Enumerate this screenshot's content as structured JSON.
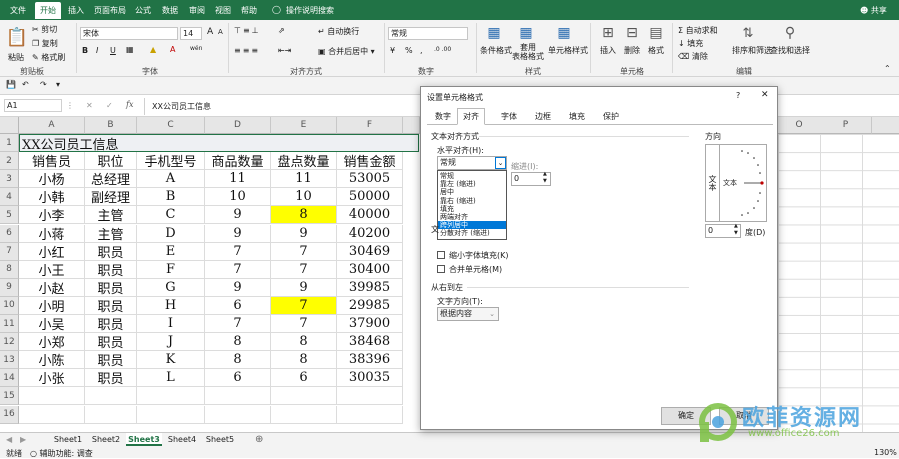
{
  "ribbon_tabs": [
    "文件",
    "开始",
    "插入",
    "页面布局",
    "公式",
    "数据",
    "审阅",
    "视图",
    "帮助",
    "操作说明搜索",
    "共享"
  ],
  "ribbon": {
    "clipboard": {
      "cut": "剪切",
      "copy": "复制",
      "format_painter": "格式刷",
      "paste": "粘贴",
      "label": "剪贴板"
    },
    "font": {
      "name": "宋体",
      "size": "14",
      "label": "字体",
      "bold": "B",
      "italic": "I",
      "underline": "U",
      "grow": "A",
      "shrink": "A",
      "wen": "wén"
    },
    "align": {
      "wrap": "自动换行",
      "merge": "合并后居中",
      "label": "对齐方式"
    },
    "number": {
      "format": "常规",
      "label": "数字",
      "pct": "%",
      "comma": ","
    },
    "styles": {
      "cond": "条件格式",
      "table": "套用\n表格格式",
      "cell": "单元格样式",
      "label": "样式"
    },
    "cells": {
      "insert": "插入",
      "delete": "删除",
      "format": "格式",
      "label": "单元格"
    },
    "editing": {
      "autosum": "自动求和",
      "fill": "填充",
      "clear": "清除",
      "sort": "排序和筛选",
      "find": "查找和选择",
      "label": "编辑"
    }
  },
  "formula_bar": {
    "name_box": "A1",
    "fx": "fx",
    "value": "XX公司员工信息"
  },
  "columns": [
    "A",
    "B",
    "C",
    "D",
    "E",
    "F"
  ],
  "extra_columns": [
    "O",
    "P"
  ],
  "rows": [
    {
      "n": "1",
      "title": "XX公司员工信息"
    },
    {
      "n": "2",
      "cells": [
        "销售员",
        "职位",
        "手机型号",
        "商品数量",
        "盘点数量",
        "销售金额"
      ]
    },
    {
      "n": "3",
      "cells": [
        "小杨",
        "总经理",
        "A",
        "11",
        "11",
        "53005"
      ]
    },
    {
      "n": "4",
      "cells": [
        "小韩",
        "副经理",
        "B",
        "10",
        "10",
        "50000"
      ]
    },
    {
      "n": "5",
      "cells": [
        "小李",
        "主管",
        "C",
        "9",
        "8",
        "40000"
      ],
      "hl": 4
    },
    {
      "n": "6",
      "cells": [
        "小蒋",
        "主管",
        "D",
        "9",
        "9",
        "40200"
      ]
    },
    {
      "n": "7",
      "cells": [
        "小红",
        "职员",
        "E",
        "7",
        "7",
        "30469"
      ]
    },
    {
      "n": "8",
      "cells": [
        "小王",
        "职员",
        "F",
        "7",
        "7",
        "30400"
      ]
    },
    {
      "n": "9",
      "cells": [
        "小赵",
        "职员",
        "G",
        "9",
        "9",
        "39985"
      ]
    },
    {
      "n": "10",
      "cells": [
        "小明",
        "职员",
        "H",
        "6",
        "7",
        "29985"
      ],
      "hl": 4
    },
    {
      "n": "11",
      "cells": [
        "小吴",
        "职员",
        "I",
        "7",
        "7",
        "37900"
      ]
    },
    {
      "n": "12",
      "cells": [
        "小郑",
        "职员",
        "J",
        "8",
        "8",
        "38468"
      ]
    },
    {
      "n": "13",
      "cells": [
        "小陈",
        "职员",
        "K",
        "8",
        "8",
        "38396"
      ]
    },
    {
      "n": "14",
      "cells": [
        "小张",
        "职员",
        "L",
        "6",
        "6",
        "30035"
      ]
    },
    {
      "n": "15",
      "cells": [
        "",
        "",
        "",
        "",
        "",
        ""
      ]
    },
    {
      "n": "16",
      "cells": [
        "",
        "",
        "",
        "",
        "",
        ""
      ]
    }
  ],
  "sheet_tabs": [
    "Sheet1",
    "Sheet2",
    "Sheet3",
    "Sheet4",
    "Sheet5"
  ],
  "active_sheet": "Sheet3",
  "status": {
    "ready": "就绪",
    "accessibility": "辅助功能: 调查",
    "zoom": "130%"
  },
  "dialog": {
    "title": "设置单元格格式",
    "help": "?",
    "tabs": [
      "数字",
      "对齐",
      "字体",
      "边框",
      "填充",
      "保护"
    ],
    "active_tab": "对齐",
    "section_align": "文本对齐方式",
    "horizontal_label": "水平对齐(H):",
    "horizontal_value": "常规",
    "indent_label": "缩进(I):",
    "indent_value": "0",
    "horizontal_options": [
      "常规",
      "靠左 (缩进)",
      "居中",
      "靠右 (缩进)",
      "填充",
      "两端对齐",
      "跨列居中",
      "分散对齐 (缩进)"
    ],
    "highlighted_option": "跨列居中",
    "text_control_partial": "文",
    "shrink": "缩小字体填充(K)",
    "merge": "合并单元格(M)",
    "section_rtl": "从右到左",
    "direction_label": "文字方向(T):",
    "direction_value": "根据内容",
    "orientation_label": "方向",
    "orientation_vertical": "文本",
    "orientation_horizontal": "文本",
    "degree_value": "0",
    "degree_label": "度(D)",
    "ok": "确定",
    "cancel": "取消"
  },
  "watermark": {
    "cn": "欧菲资源网",
    "url": "www.office26.com"
  }
}
